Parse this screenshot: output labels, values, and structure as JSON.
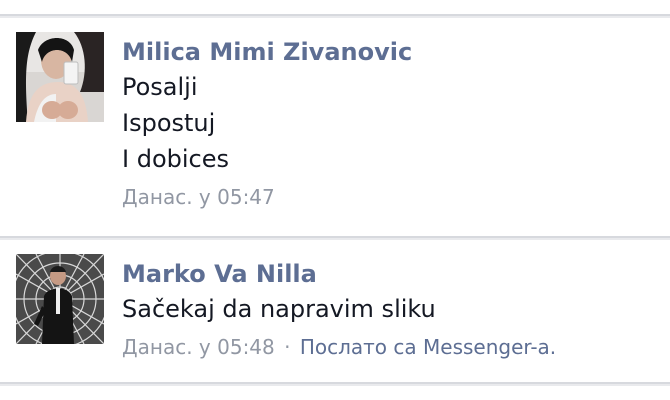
{
  "messages": [
    {
      "sender": "Milica Mimi Zivanovic",
      "lines": [
        "Posalji",
        "Ispostuj",
        "I dobices"
      ],
      "time": "Данас. у 05:47"
    },
    {
      "sender": "Marko Va Nilla",
      "lines": [
        "Sačekaj da napravim sliku"
      ],
      "time": "Данас. у 05:48",
      "separator": "·",
      "via": "Послато са Messenger-а."
    }
  ],
  "colors": {
    "sender_link": "#5d6e93",
    "message_text": "#141823",
    "meta_text": "#9197a3",
    "background": "#e9eaed"
  }
}
